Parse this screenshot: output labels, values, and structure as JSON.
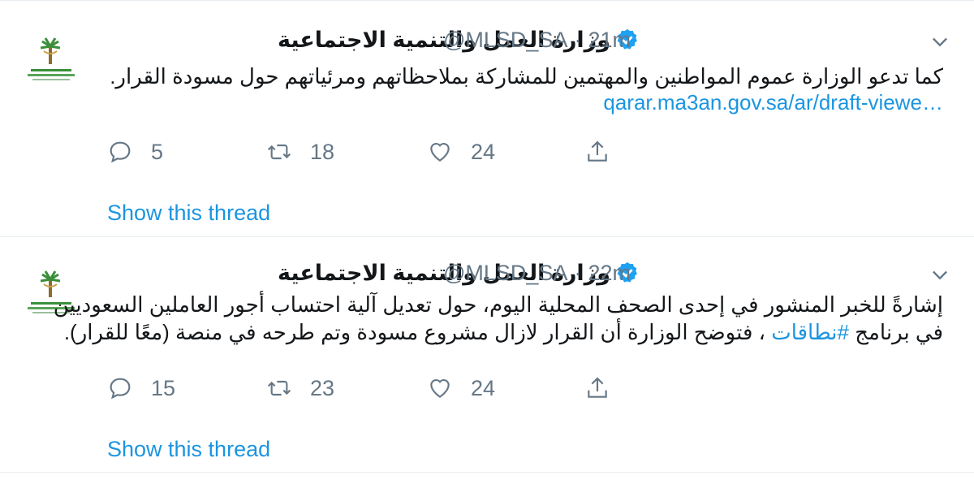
{
  "tweets": [
    {
      "display_name": "وزارة العمل والتنمية الاجتماعية",
      "handle": "@MLSD_SA",
      "separator": "·",
      "time": "21m",
      "text_lines": [
        "كما تدعو الوزارة عموم المواطنين والمهتمين للمشاركة بملاحظاتهم ومرئياتهم حول مسودة القرار."
      ],
      "link": "qarar.ma3an.gov.sa/ar/draft-viewe…",
      "counts": {
        "replies": "5",
        "retweets": "18",
        "likes": "24"
      },
      "show_thread": "Show this thread"
    },
    {
      "display_name": "وزارة العمل والتنمية الاجتماعية",
      "handle": "@MLSD_SA",
      "separator": "·",
      "time": "22m",
      "text_lines": [
        "إشارةً للخبر المنشور في إحدى الصحف المحلية اليوم، حول تعديل آلية احتساب أجور العاملين السعوديين",
        "في برنامج ",
        "#نطاقات",
        " ، فتوضح الوزارة أن القرار لازال مشروع مسودة وتم طرحه في منصة (معًا للقرار)."
      ],
      "counts": {
        "replies": "15",
        "retweets": "23",
        "likes": "24"
      },
      "show_thread": "Show this thread"
    }
  ],
  "colors": {
    "accent": "#1b95e0",
    "muted": "#657786",
    "verified": "#1da1f2"
  },
  "icons": [
    "palm-logo-icon",
    "verified-icon",
    "chevron-down-icon",
    "reply-icon",
    "retweet-icon",
    "like-icon",
    "share-icon"
  ]
}
